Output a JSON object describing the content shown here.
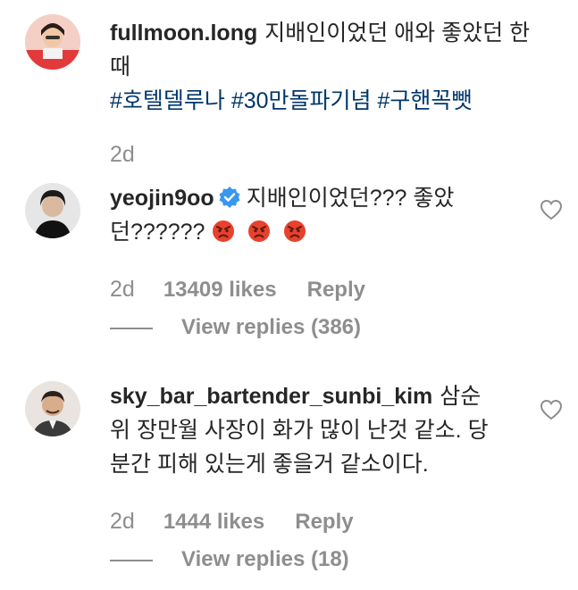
{
  "comments": [
    {
      "username": "fullmoon.long",
      "text_line1": "지배인이었던 애와 좋았던 한",
      "text_line2": "때",
      "hashtags": "#호텔델루나 #30만돌파기념 #구핸꼭뺏",
      "age": "2d"
    },
    {
      "username": "yeojin9oo",
      "verified": true,
      "text_line1": "지배인이었던??? 좋았",
      "text_line2": "던??????",
      "emoji": "angry-face",
      "age": "2d",
      "likes": "13409 likes",
      "reply_label": "Reply",
      "view_replies": "View replies (386)"
    },
    {
      "username": "sky_bar_bartender_sunbi_kim",
      "text_line1": "삼순",
      "text_line2": "위 장만월 사장이 화가 많이 난것 같소. 당",
      "text_line3": "분간 피해 있는게 좋을거 같소이다.",
      "age": "2d",
      "likes": "1444 likes",
      "reply_label": "Reply",
      "view_replies": "View replies (18)"
    }
  ],
  "colors": {
    "text": "#262626",
    "muted": "#8e8e8e",
    "hashtag": "#00376b",
    "verified": "#3897f0",
    "emoji_red": "#e8412c"
  }
}
